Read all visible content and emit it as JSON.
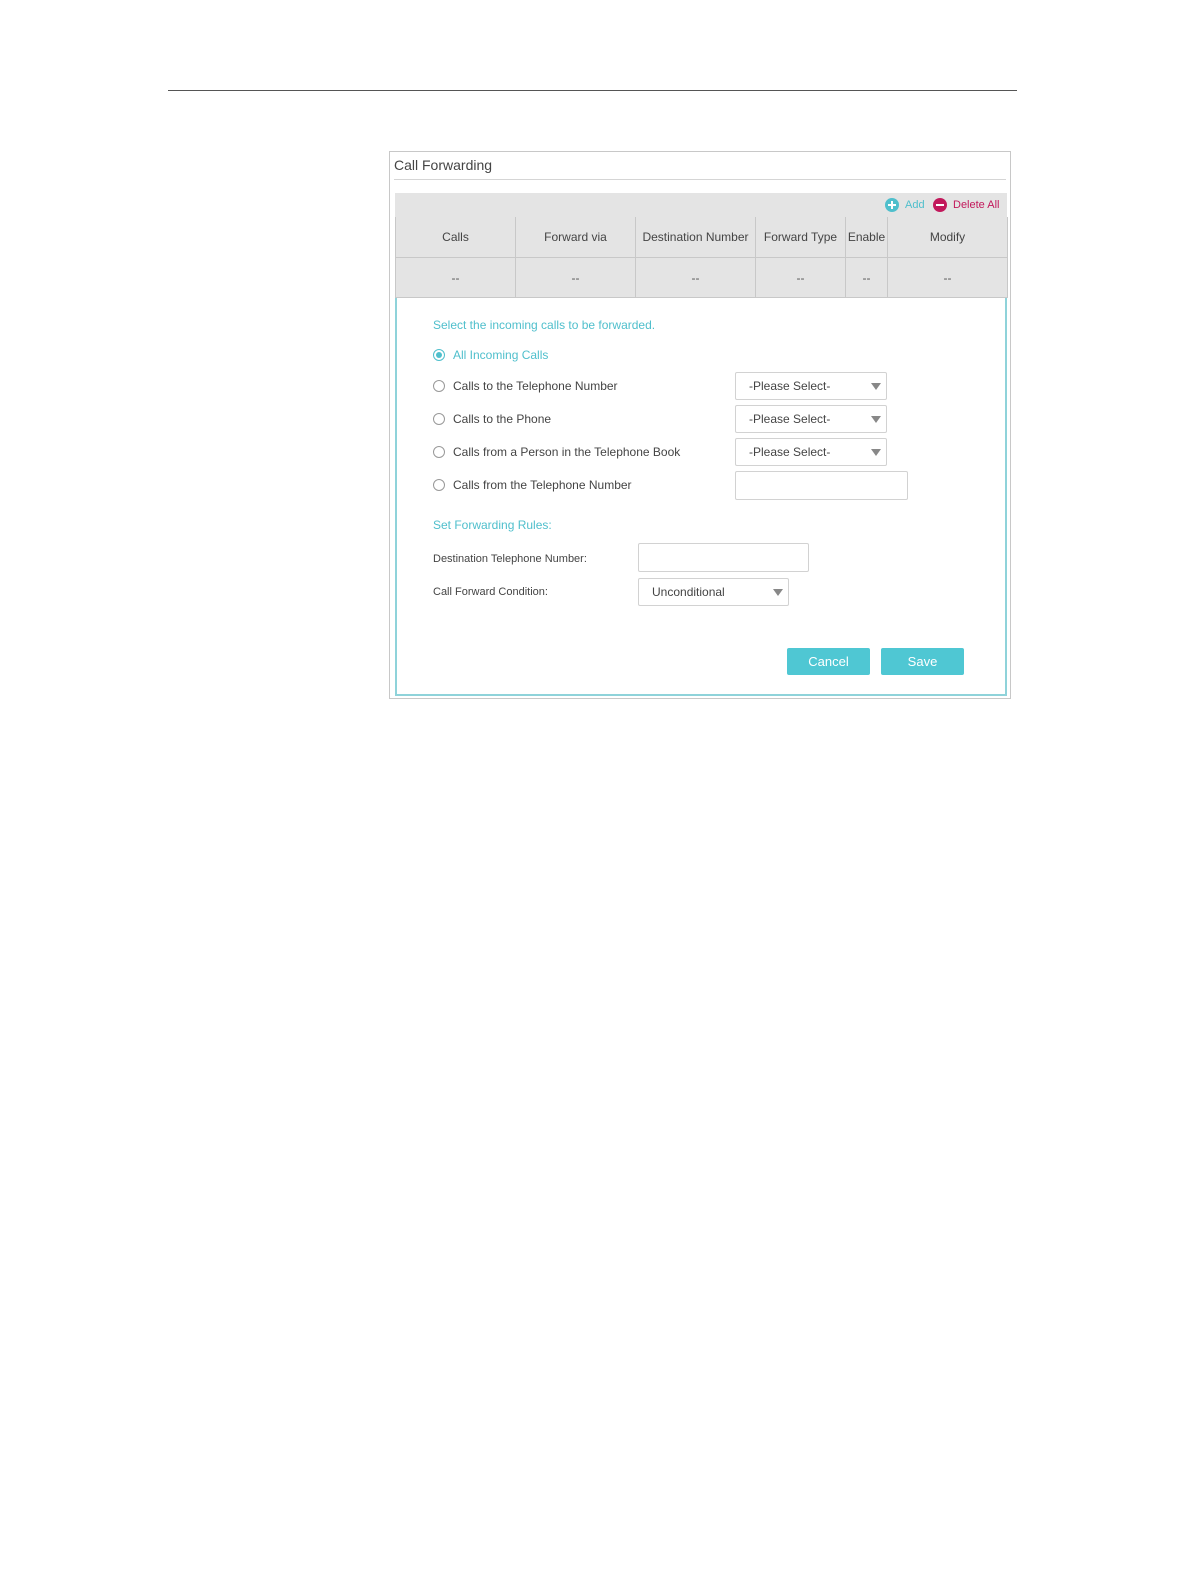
{
  "panel": {
    "title": "Call Forwarding"
  },
  "toolbar": {
    "add_label": "Add",
    "add_icon": "plus-circle-icon",
    "delete_all_label": "Delete All",
    "delete_all_icon": "minus-circle-icon"
  },
  "table": {
    "columns": [
      "Calls",
      "Forward via",
      "Destination Number",
      "Forward Type",
      "Enable",
      "Modify"
    ],
    "row": [
      "--",
      "--",
      "--",
      "--",
      "--",
      "--"
    ]
  },
  "form": {
    "incoming_heading": "Select the incoming calls to be forwarded.",
    "options": [
      {
        "label": "All Incoming Calls",
        "checked": true
      },
      {
        "label": "Calls to the Telephone Number",
        "checked": false,
        "select_value": "-Please Select-"
      },
      {
        "label": "Calls to the Phone",
        "checked": false,
        "select_value": "-Please Select-"
      },
      {
        "label": "Calls from a Person in the Telephone Book",
        "checked": false,
        "select_value": "-Please Select-"
      },
      {
        "label": "Calls from the Telephone Number",
        "checked": false,
        "input_value": ""
      }
    ],
    "rules_heading": "Set Forwarding Rules:",
    "destination_label": "Destination Telephone Number:",
    "destination_value": "",
    "condition_label": "Call Forward Condition:",
    "condition_value": "Unconditional"
  },
  "buttons": {
    "cancel": "Cancel",
    "save": "Save"
  },
  "colors": {
    "accent": "#4fbfcc",
    "danger": "#c2185b"
  }
}
